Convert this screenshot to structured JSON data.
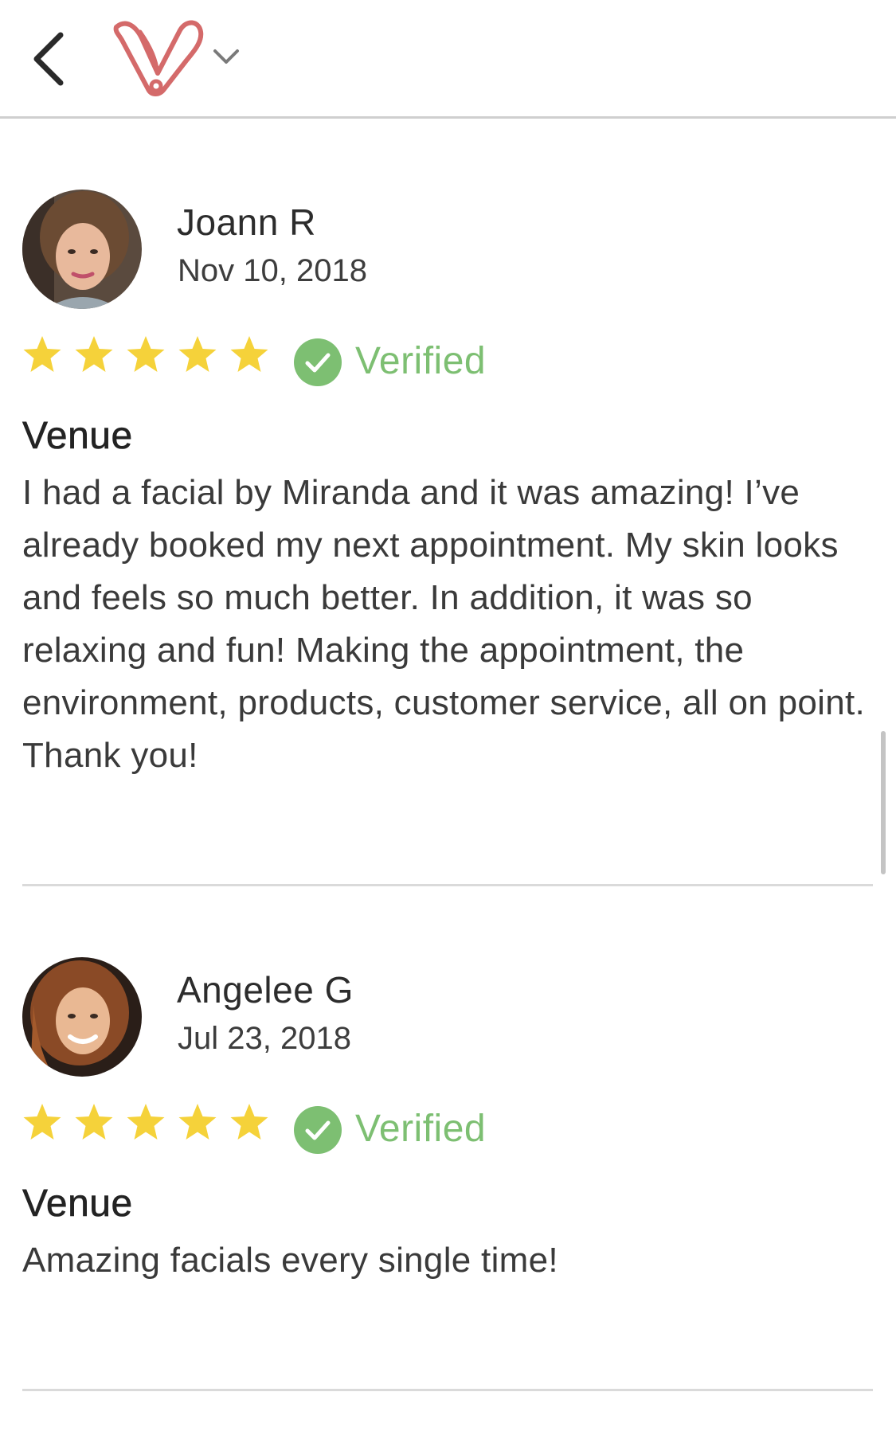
{
  "header": {
    "back_icon": "chevron-left-icon",
    "logo_icon": "brand-v-logo",
    "menu_icon": "chevron-down-icon",
    "brand_color": "#d46a6a"
  },
  "reviews": [
    {
      "name": "Joann R",
      "date": "Nov 10, 2018",
      "rating": 5,
      "verified_label": "Verified",
      "category": "Venue",
      "text": "I had a facial by Miranda and it was amazing! I’ve already booked my next appointment. My skin looks and feels so much better. In addition, it was so relaxing and fun! Making the appointment, the environment, products, customer service, all on point. Thank you!"
    },
    {
      "name": "Angelee G",
      "date": "Jul 23, 2018",
      "rating": 5,
      "verified_label": "Verified",
      "category": "Venue",
      "text": "Amazing facials every single time!"
    }
  ],
  "colors": {
    "star": "#f5d23a",
    "verified": "#7dbf72",
    "divider": "#dadada"
  }
}
